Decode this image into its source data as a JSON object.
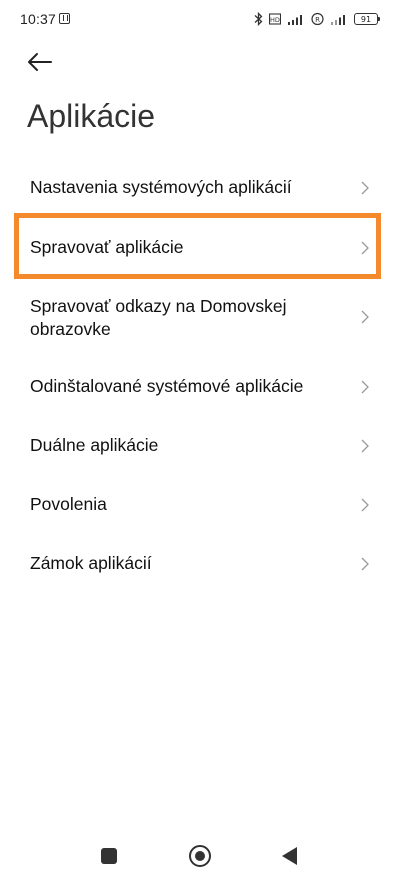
{
  "status_bar": {
    "time": "10:37",
    "battery_level": "91",
    "icons": [
      "nfc-icon",
      "bluetooth-icon",
      "hd-icon",
      "signal-icon",
      "roaming-icon",
      "signal-icon",
      "battery-icon"
    ]
  },
  "header": {
    "back_icon": "back-arrow-icon",
    "title": "Aplikácie"
  },
  "menu": {
    "items": [
      {
        "label": "Nastavenia systémových aplikácií"
      },
      {
        "label": "Spravovať aplikácie",
        "highlighted": true
      },
      {
        "label": "Spravovať odkazy na Domovskej obrazovke"
      },
      {
        "label": "Odinštalované systémové aplikácie"
      },
      {
        "label": "Duálne aplikácie"
      },
      {
        "label": "Povolenia"
      },
      {
        "label": "Zámok aplikácií"
      }
    ]
  },
  "navigation_bar": {
    "buttons": [
      "recents-square-icon",
      "home-circle-icon",
      "back-triangle-icon"
    ]
  },
  "colors": {
    "highlight": "#f58a2c",
    "text": "#111111",
    "title": "#333333",
    "chevron": "#9a9a9a"
  }
}
